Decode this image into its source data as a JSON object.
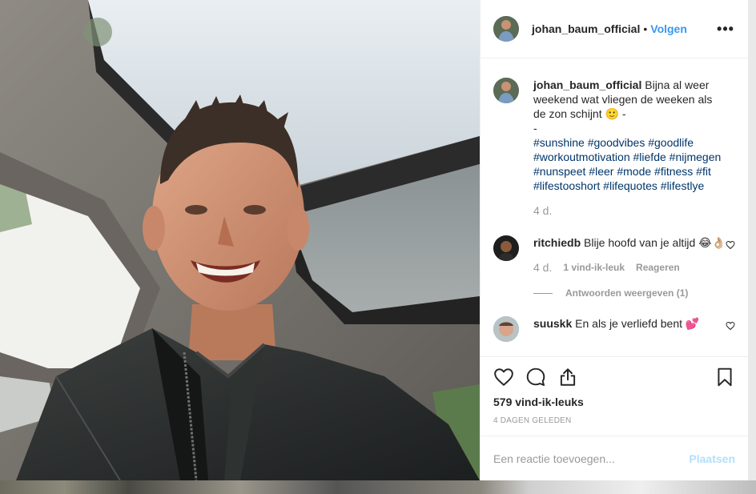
{
  "post": {
    "author": "johan_baum_official",
    "separator": "•",
    "follow_label": "Volgen",
    "more_label": "•••",
    "caption": {
      "text": "Bijna al weer weekend wat vliegen de weeken als de zon schijnt 🙂 -",
      "spacer": "-",
      "hashtags": [
        "#sunshine",
        "#goodvibes",
        "#goodlife",
        "#workoutmotivation",
        "#liefde",
        "#nijmegen",
        "#nunspeet",
        "#leer",
        "#mode",
        "#fitness",
        "#fit",
        "#lifestooshort",
        "#lifequotes",
        "#lifestlye"
      ],
      "age": "4 d."
    },
    "comments": [
      {
        "username": "ritchiedb",
        "text": "Blije hoofd van je altijd 😂👌🏼",
        "age": "4 d.",
        "likes": "1 vind-ik-leuk",
        "reply_label": "Reageren",
        "view_replies": "Antwoorden weergeven (1)"
      },
      {
        "username": "suuskk",
        "text": "En als je verliefd bent 💕"
      }
    ],
    "like_count": "579 vind-ik-leuks",
    "timestamp": "4 DAGEN GELEDEN",
    "comment_placeholder": "Een reactie toevoegen...",
    "post_button": "Plaatsen"
  },
  "icons": {
    "more": "more-options-icon",
    "like": "heart-icon",
    "comment": "comment-bubble-icon",
    "share": "share-icon",
    "save": "bookmark-icon",
    "comment_like": "small-heart-icon"
  },
  "colors": {
    "accent": "#3897f0",
    "hashtag": "#003569",
    "muted": "#999999",
    "post_disabled": "#b2dffc",
    "border": "#efefef"
  }
}
